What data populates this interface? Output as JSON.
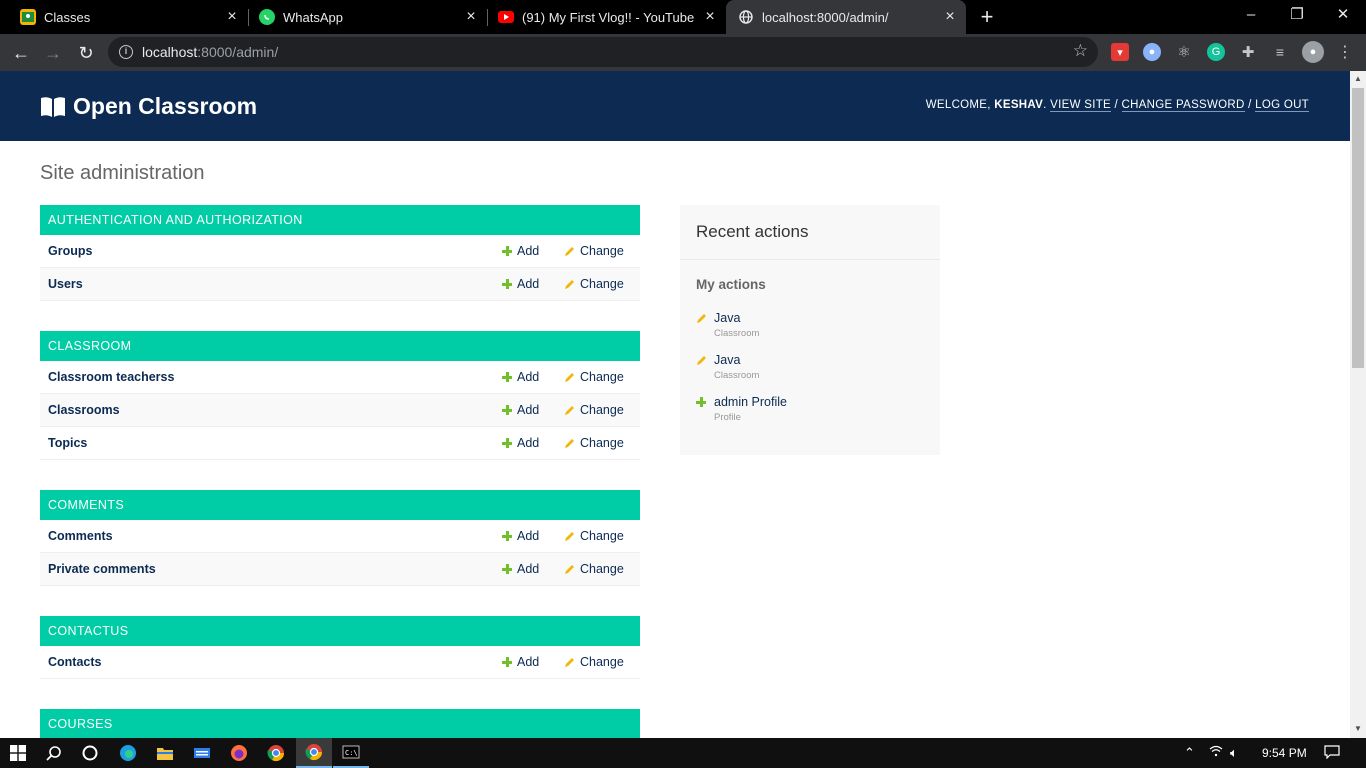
{
  "browser": {
    "tabs": [
      {
        "title": "Classes",
        "icon": "classroom-icon"
      },
      {
        "title": "WhatsApp",
        "icon": "whatsapp-icon"
      },
      {
        "title": "(91) My First Vlog!! - YouTube",
        "icon": "youtube-icon"
      },
      {
        "title": "localhost:8000/admin/",
        "icon": "globe-icon",
        "active": true
      }
    ],
    "url_host": "localhost",
    "url_rest": ":8000/admin/"
  },
  "header": {
    "brand": "Open Classroom",
    "welcome": "WELCOME,",
    "username": "KESHAV",
    "view_site": "VIEW SITE",
    "change_password": "CHANGE PASSWORD",
    "log_out": "LOG OUT"
  },
  "page_title": "Site administration",
  "actions": {
    "add": "Add",
    "change": "Change"
  },
  "modules": [
    {
      "caption": "AUTHENTICATION AND AUTHORIZATION",
      "rows": [
        "Groups",
        "Users"
      ]
    },
    {
      "caption": "CLASSROOM",
      "rows": [
        "Classroom teacherss",
        "Classrooms",
        "Topics"
      ]
    },
    {
      "caption": "COMMENTS",
      "rows": [
        "Comments",
        "Private comments"
      ]
    },
    {
      "caption": "CONTACTUS",
      "rows": [
        "Contacts"
      ]
    },
    {
      "caption": "COURSES",
      "rows": []
    }
  ],
  "recent": {
    "title": "Recent actions",
    "subtitle": "My actions",
    "items": [
      {
        "label": "Java",
        "type": "Classroom",
        "kind": "change"
      },
      {
        "label": "Java",
        "type": "Classroom",
        "kind": "change"
      },
      {
        "label": "admin Profile",
        "type": "Profile",
        "kind": "add"
      }
    ]
  },
  "taskbar": {
    "time": "9:54 PM"
  },
  "colors": {
    "header": "#0c2a52",
    "module_caption": "#00cda6",
    "add": "#70bf2b",
    "change": "#efb80b"
  }
}
